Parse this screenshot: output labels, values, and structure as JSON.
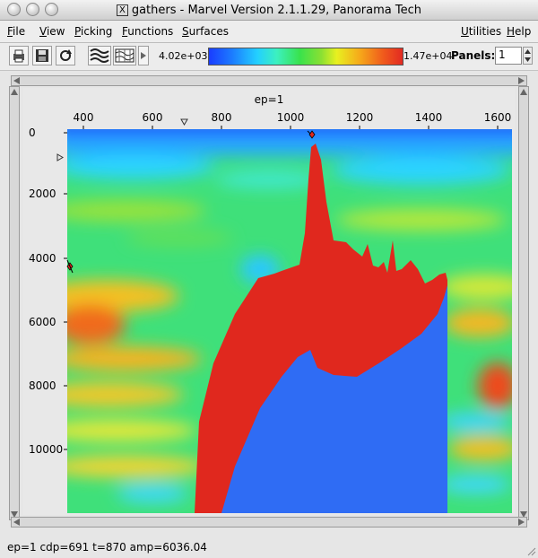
{
  "window": {
    "title": "gathers - Marvel Version 2.1.1.29, Panorama Tech",
    "x_logo": "X"
  },
  "menu": {
    "left": [
      "File",
      "View",
      "Picking",
      "Functions",
      "Surfaces"
    ],
    "right": [
      "Utilities",
      "Help"
    ]
  },
  "toolbar": {
    "icons": [
      "print-icon",
      "save-icon",
      "refresh-icon",
      "wiggle-display-icon",
      "variable-density-icon",
      "expand-arrow-icon"
    ],
    "colorbar": {
      "min_label": "4.02e+03",
      "max_label": "1.47e+04"
    },
    "panels_label": "Panels:",
    "panels_value": "1"
  },
  "plot": {
    "title": "ep=1",
    "x_ticks": [
      "400",
      "600",
      "800",
      "1000",
      "1200",
      "1400",
      "1600"
    ],
    "y_ticks": [
      "0",
      "2000",
      "4000",
      "6000",
      "8000",
      "10000"
    ],
    "colors": {
      "background_green": "#3fe07a",
      "salt_red": "#e0281e",
      "subsalt_blue": "#2f6cf4"
    }
  },
  "status": {
    "text": "ep=1   cdp=691  t=870  amp=6036.04"
  }
}
